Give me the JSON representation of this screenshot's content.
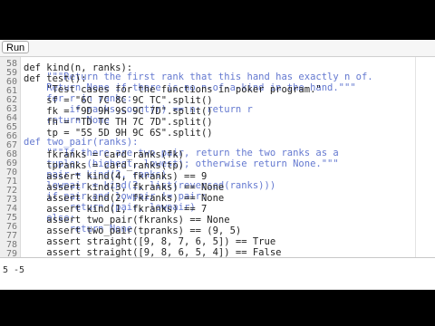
{
  "toolbar": {
    "run_label": "Run"
  },
  "gutter": {
    "numbers": [
      "58",
      "59",
      "60",
      "61",
      "62",
      "63",
      "64",
      "65",
      "66",
      "67",
      "68",
      "69",
      "70",
      "71",
      "72",
      "73",
      "74",
      "75",
      "76",
      "77",
      "78",
      "79"
    ]
  },
  "code": {
    "lines": [
      "def kind(n, ranks):",
      "def test():",
      "    \"Test cases for the functions in poker program.\"",
      "    sf = \"6C 7C 8C 9C TC\".split()",
      "    fk = \"9D 9H 9S 9C 7D\".split()",
      "    fh = \"TD TC TH 7C 7D\".split()",
      "    tp = \"5S 5D 9H 9C 6S\".split()",
      "",
      "    fkranks = card_ranks(fk)",
      "    tpranks = card_ranks(tp)",
      "    assert kind(4, fkranks) == 9",
      "    assert kind(3, fkranks) == None",
      "    assert kind(2, fkranks) == None",
      "    assert kind(1, fkranks) == 7",
      "    assert two_pair(fkranks) == None",
      "    assert two_pair(tpranks) == (9, 5)",
      "    assert straight([9, 8, 7, 6, 5]) == True",
      "    assert straight([9, 8, 6, 5, 4]) == False"
    ],
    "ghost_lines": [
      "    \"\"\"Return the first rank that this hand has exactly n of.",
      "    Return None if there is no n-of-a-kind in the hand.\"\"\"",
      "    for r in ranks:",
      "        if ranks.count(r) == n: return r",
      "    return None",
      "",
      "def two_pair(ranks):",
      "    \"\"\"If there are two pair, return the two ranks as a",
      "    tuple: (highest, lowest); otherwise return None.\"\"\"",
      "    pair = kind(2, ranks)",
      "    lowpair = kind(2, list(reversed(ranks)))",
      "    if pair and lowpair != pair:",
      "        return (pair, lowpair)",
      "    else:",
      "        return None"
    ]
  },
  "console": {
    "output": "5 -5"
  }
}
